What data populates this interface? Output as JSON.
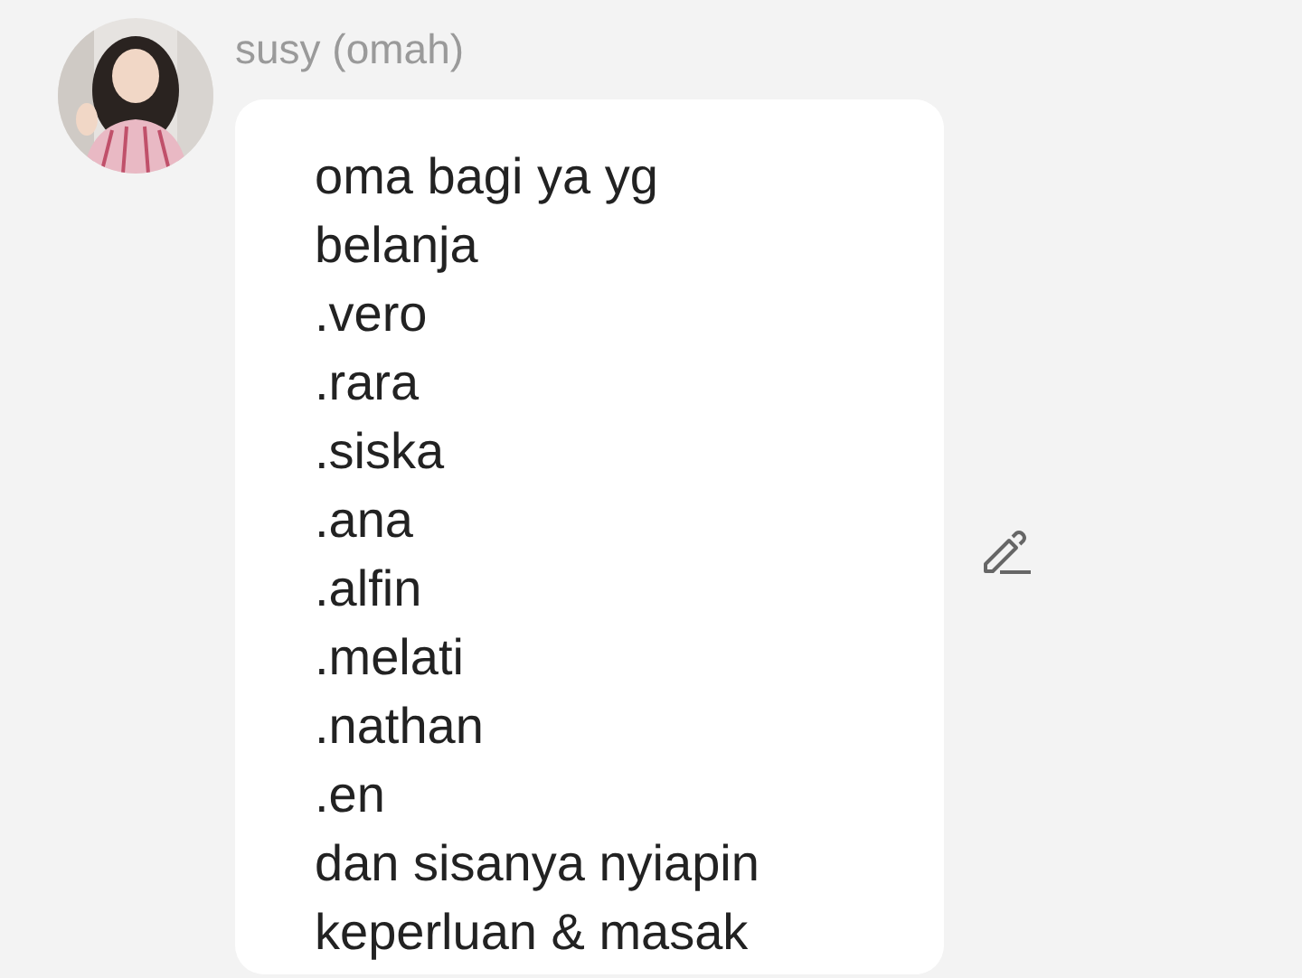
{
  "message": {
    "sender": "susy (omah)",
    "text": "oma bagi ya yg\nbelanja\n.vero\n.rara\n.siska\n.ana\n.alfin\n.melati\n.nathan\n.en\ndan sisanya nyiapin\nkeperluan & masak",
    "editable": true
  }
}
